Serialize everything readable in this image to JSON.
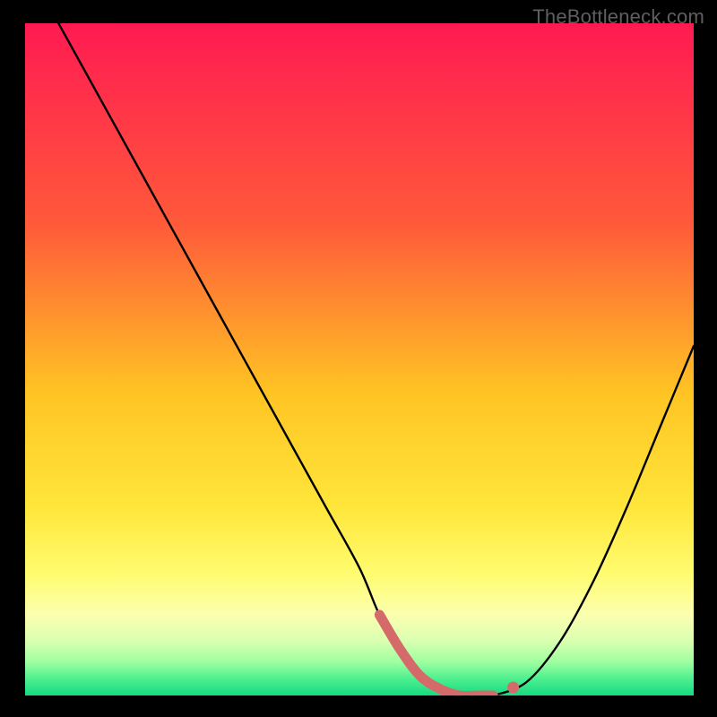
{
  "watermark": "TheBottleneck.com",
  "chart_data": {
    "type": "line",
    "title": "",
    "xlabel": "",
    "ylabel": "",
    "xlim": [
      0,
      100
    ],
    "ylim": [
      0,
      100
    ],
    "x": [
      5,
      10,
      15,
      20,
      25,
      30,
      35,
      40,
      45,
      50,
      53,
      56,
      59,
      62,
      65,
      68,
      70,
      75,
      80,
      85,
      90,
      95,
      100
    ],
    "values": [
      100,
      91,
      82,
      73,
      64,
      55,
      46,
      37,
      28,
      19,
      12,
      7,
      3,
      1,
      0,
      0,
      0,
      2,
      8,
      17,
      28,
      40,
      52
    ],
    "highlight_segment": {
      "x_start": 53,
      "x_end": 70
    },
    "highlight_dot_x": 73,
    "gradient_stops": [
      {
        "offset": 0.0,
        "color": "#ff1a52"
      },
      {
        "offset": 0.3,
        "color": "#ff5a3a"
      },
      {
        "offset": 0.55,
        "color": "#ffc423"
      },
      {
        "offset": 0.72,
        "color": "#ffe63a"
      },
      {
        "offset": 0.82,
        "color": "#fffc70"
      },
      {
        "offset": 0.88,
        "color": "#fcffb0"
      },
      {
        "offset": 0.92,
        "color": "#d8ffb0"
      },
      {
        "offset": 0.95,
        "color": "#9effa0"
      },
      {
        "offset": 0.975,
        "color": "#4ef08f"
      },
      {
        "offset": 1.0,
        "color": "#14db82"
      }
    ]
  }
}
